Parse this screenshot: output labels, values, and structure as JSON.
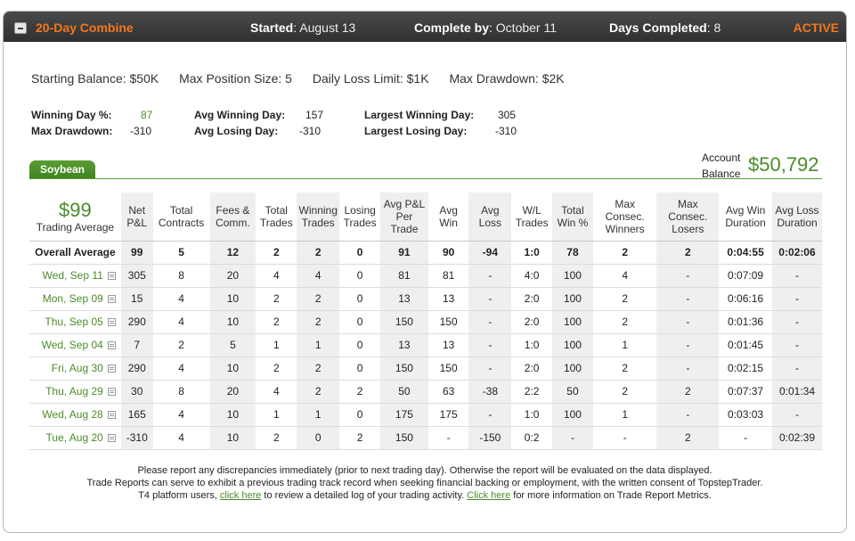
{
  "header": {
    "title": "20-Day Combine",
    "started_label": "Started",
    "started_value": "August 13",
    "complete_label": "Complete by",
    "complete_value": "October 11",
    "days_label": "Days Completed",
    "days_value": "8",
    "status": "ACTIVE"
  },
  "limits": {
    "starting_balance": "Starting Balance: $50K",
    "max_position": "Max Position Size: 5",
    "daily_loss": "Daily Loss Limit: $1K",
    "max_drawdown": "Max Drawdown: $2K"
  },
  "stats": {
    "winning_day_pct_label": "Winning Day %:",
    "winning_day_pct": "87",
    "max_drawdown_label": "Max Drawdown:",
    "max_drawdown": "-310",
    "avg_winning_day_label": "Avg Winning Day:",
    "avg_winning_day": "157",
    "avg_losing_day_label": "Avg Losing Day:",
    "avg_losing_day": "-310",
    "largest_winning_day_label": "Largest Winning Day:",
    "largest_winning_day": "305",
    "largest_losing_day_label": "Largest Losing Day:",
    "largest_losing_day": "-310"
  },
  "product_tab": "Soybean",
  "account": {
    "label_line1": "Account",
    "label_line2": "Balance",
    "value": "$50,792"
  },
  "trading_average": {
    "value": "$99",
    "label": "Trading Average"
  },
  "columns": [
    "Net P&L",
    "Total Contracts",
    "Fees & Comm.",
    "Total Trades",
    "Winning Trades",
    "Losing Trades",
    "Avg P&L Per Trade",
    "Avg Win",
    "Avg Loss",
    "W/L Trades",
    "Total Win %",
    "Max Consec. Winners",
    "Max Consec. Losers",
    "Avg Win Duration",
    "Avg Loss Duration"
  ],
  "overall": {
    "label": "Overall Average",
    "cells": [
      "99",
      "5",
      "12",
      "2",
      "2",
      "0",
      "91",
      "90",
      "-94",
      "1:0",
      "78",
      "2",
      "2",
      "0:04:55",
      "0:02:06"
    ]
  },
  "rows": [
    {
      "date": "Wed, Sep 11",
      "cells": [
        "305",
        "8",
        "20",
        "4",
        "4",
        "0",
        "81",
        "81",
        "-",
        "4:0",
        "100",
        "4",
        "-",
        "0:07:09",
        "-"
      ]
    },
    {
      "date": "Mon, Sep 09",
      "cells": [
        "15",
        "4",
        "10",
        "2",
        "2",
        "0",
        "13",
        "13",
        "-",
        "2:0",
        "100",
        "2",
        "-",
        "0:06:16",
        "-"
      ]
    },
    {
      "date": "Thu, Sep 05",
      "cells": [
        "290",
        "4",
        "10",
        "2",
        "2",
        "0",
        "150",
        "150",
        "-",
        "2:0",
        "100",
        "2",
        "-",
        "0:01:36",
        "-"
      ]
    },
    {
      "date": "Wed, Sep 04",
      "cells": [
        "7",
        "2",
        "5",
        "1",
        "1",
        "0",
        "13",
        "13",
        "-",
        "1:0",
        "100",
        "1",
        "-",
        "0:01:45",
        "-"
      ]
    },
    {
      "date": "Fri, Aug 30",
      "cells": [
        "290",
        "4",
        "10",
        "2",
        "2",
        "0",
        "150",
        "150",
        "-",
        "2:0",
        "100",
        "2",
        "-",
        "0:02:15",
        "-"
      ]
    },
    {
      "date": "Thu, Aug 29",
      "cells": [
        "30",
        "8",
        "20",
        "4",
        "2",
        "2",
        "50",
        "63",
        "-38",
        "2:2",
        "50",
        "2",
        "2",
        "0:07:37",
        "0:01:34"
      ]
    },
    {
      "date": "Wed, Aug 28",
      "cells": [
        "165",
        "4",
        "10",
        "1",
        "1",
        "0",
        "175",
        "175",
        "-",
        "1:0",
        "100",
        "1",
        "-",
        "0:03:03",
        "-"
      ]
    },
    {
      "date": "Tue, Aug 20",
      "cells": [
        "-310",
        "4",
        "10",
        "2",
        "0",
        "2",
        "150",
        "-",
        "-150",
        "0:2",
        "-",
        "-",
        "2",
        "-",
        "0:02:39"
      ]
    }
  ],
  "footer": {
    "line1": "Please report any discrepancies immediately (prior to next trading day). Otherwise the report will be evaluated on the data displayed.",
    "line2": "Trade Reports can serve to exhibit a previous trading track record when seeking financial backing or employment, with the written consent of TopstepTrader.",
    "line3_a": "T4 platform users, ",
    "link1": "click here",
    "line3_b": " to review a detailed log of your trading activity. ",
    "link2": "Click here",
    "line3_c": " for more information on Trade Report Metrics."
  }
}
